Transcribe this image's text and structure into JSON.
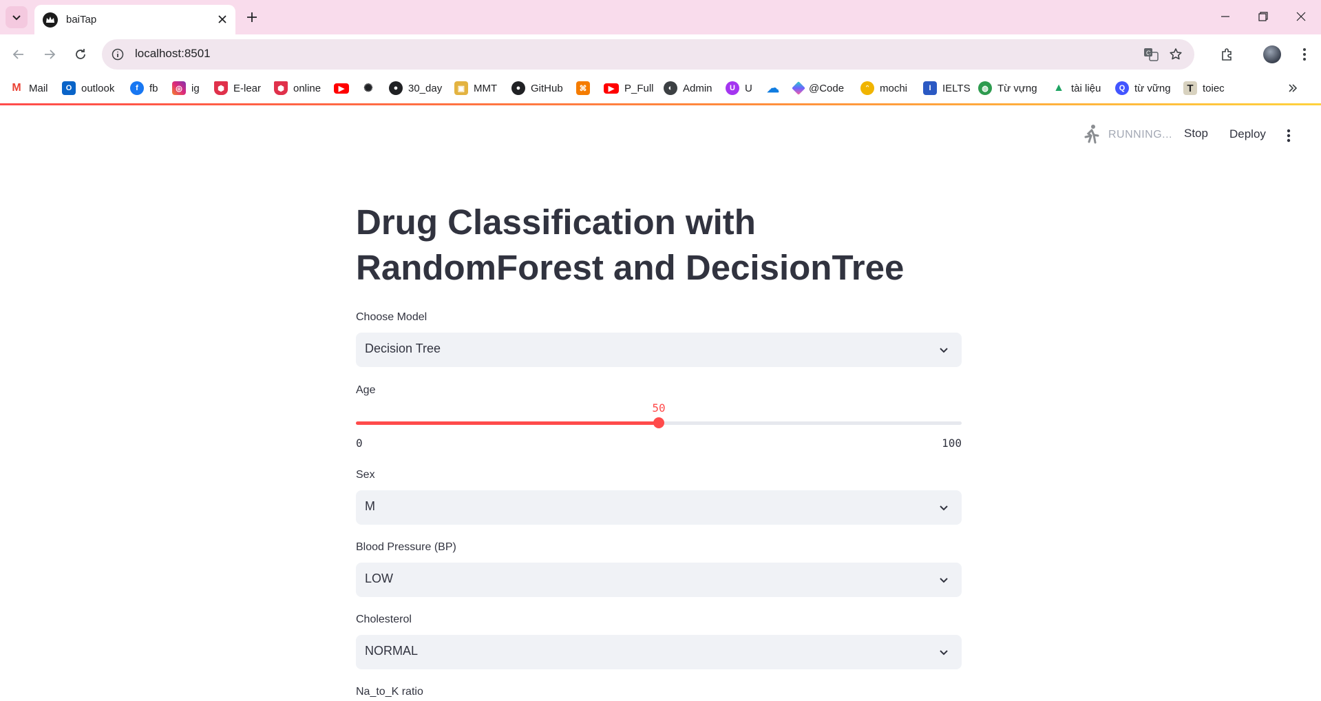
{
  "browser": {
    "tab": {
      "title": "baiTap"
    },
    "address": {
      "url": "localhost:8501"
    },
    "bookmarks": [
      {
        "label": "Mail",
        "icon": "gmail-icon",
        "color": "#ea4335"
      },
      {
        "label": "outlook",
        "icon": "outlook-icon",
        "color": "#0a64c8"
      },
      {
        "label": "fb",
        "icon": "facebook-icon",
        "color": "#1877f2"
      },
      {
        "label": "ig",
        "icon": "instagram-icon",
        "color": "#d6249f"
      },
      {
        "label": "E-lear",
        "icon": "shield-icon",
        "color": "#e0314b"
      },
      {
        "label": "online",
        "icon": "shield-icon",
        "color": "#e0314b"
      },
      {
        "label": "",
        "icon": "youtube-icon",
        "color": "#ff0000"
      },
      {
        "label": "",
        "icon": "openai-icon",
        "color": "#202124"
      },
      {
        "label": "30_day",
        "icon": "github-icon",
        "color": "#202124"
      },
      {
        "label": "MMT",
        "icon": "classroom-icon",
        "color": "#e3b341"
      },
      {
        "label": "GitHub",
        "icon": "github-icon",
        "color": "#202124"
      },
      {
        "label": "",
        "icon": "xampp-icon",
        "color": "#f57c00"
      },
      {
        "label": "P_Full",
        "icon": "youtube-icon",
        "color": "#ff0000"
      },
      {
        "label": "Admin",
        "icon": "globe-icon",
        "color": "#202124"
      },
      {
        "label": "U",
        "icon": "udemy-icon",
        "color": "#a435f0"
      },
      {
        "label": "",
        "icon": "onedrive-icon",
        "color": "#0f7ce0"
      },
      {
        "label": "@Code",
        "icon": "code-icon",
        "color": "#6c63ff"
      },
      {
        "label": "mochi",
        "icon": "mochi-icon",
        "color": "#f0b400"
      },
      {
        "label": "IELTS",
        "icon": "ielts-icon",
        "color": "#2b59c3"
      },
      {
        "label": "Từ vựng",
        "icon": "earth-icon",
        "color": "#2e9b4f"
      },
      {
        "label": "tài liệu",
        "icon": "drive-icon",
        "color": "#1fa463"
      },
      {
        "label": "từ vững",
        "icon": "quizlet-icon",
        "color": "#4255ff"
      },
      {
        "label": "toiec",
        "icon": "t-icon",
        "color": "#5f5a4c"
      }
    ]
  },
  "app": {
    "status_text": "RUNNING...",
    "stop_label": "Stop",
    "deploy_label": "Deploy",
    "title": "Drug Classification with RandomForest and DecisionTree",
    "model": {
      "label": "Choose Model",
      "value": "Decision Tree"
    },
    "age": {
      "label": "Age",
      "value": 50,
      "min": 0,
      "max": 100,
      "value_text": "50",
      "min_text": "0",
      "max_text": "100"
    },
    "sex": {
      "label": "Sex",
      "value": "M"
    },
    "bp": {
      "label": "Blood Pressure (BP)",
      "value": "LOW"
    },
    "cholesterol": {
      "label": "Cholesterol",
      "value": "NORMAL"
    },
    "na_to_k": {
      "label": "Na_to_K ratio"
    }
  },
  "colors": {
    "accent": "#ff4b4b",
    "text": "#31333f",
    "select_bg": "#f0f2f6",
    "tab_strip": "#f9dcec"
  }
}
